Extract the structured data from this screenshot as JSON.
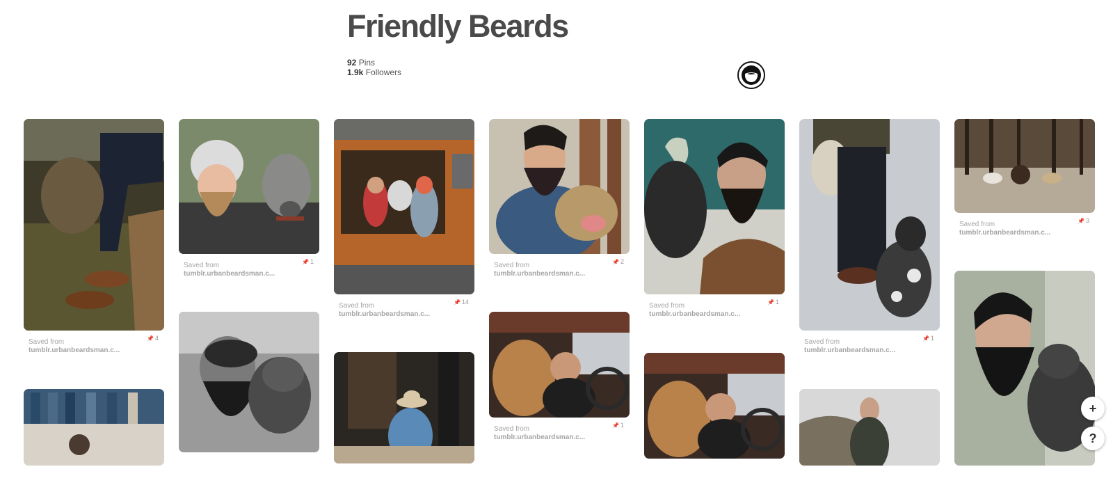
{
  "board": {
    "title": "Friendly Beards",
    "pins_count": "92",
    "pins_label": "Pins",
    "followers_count": "1.9k",
    "followers_label": "Followers"
  },
  "owner": {
    "avatar_icon": "beard-logo-icon"
  },
  "pins": [
    {
      "image": "man-sitting-with-cattle-dog-boots",
      "saved_label": "Saved from",
      "source": "tumblr.urbanbeardsman.c...",
      "repins": "4"
    },
    {
      "image": "denim-clothing-rack",
      "saved_label": "",
      "source": "",
      "repins": ""
    },
    {
      "image": "bearded-man-beanie-with-greyhound",
      "saved_label": "Saved from",
      "source": "tumblr.urbanbeardsman.c...",
      "repins": "1"
    },
    {
      "image": "bw-bearded-man-with-dog",
      "saved_label": "",
      "source": "",
      "repins": ""
    },
    {
      "image": "couple-with-dog-in-orange-van",
      "saved_label": "Saved from",
      "source": "tumblr.urbanbeardsman.c...",
      "repins": "14"
    },
    {
      "image": "man-in-hat-sitting-doorway",
      "saved_label": "",
      "source": "",
      "repins": ""
    },
    {
      "image": "bearded-man-denim-shirt-with-dog",
      "saved_label": "Saved from",
      "source": "tumblr.urbanbeardsman.c...",
      "repins": "2"
    },
    {
      "image": "man-driving-truck-with-dog",
      "saved_label": "Saved from",
      "source": "tumblr.urbanbeardsman.c...",
      "repins": "1"
    },
    {
      "image": "bearded-man-and-dog-teal-wall",
      "saved_label": "Saved from",
      "source": "tumblr.urbanbeardsman.c...",
      "repins": "1"
    },
    {
      "image": "man-driving-truck-with-dog-2",
      "saved_label": "",
      "source": "",
      "repins": ""
    },
    {
      "image": "man-standing-with-cattle-dog",
      "saved_label": "Saved from",
      "source": "tumblr.urbanbeardsman.c...",
      "repins": "1"
    },
    {
      "image": "man-in-jacket-outdoors",
      "saved_label": "",
      "source": "",
      "repins": ""
    },
    {
      "image": "dogs-in-forest",
      "saved_label": "Saved from",
      "source": "tumblr.urbanbeardsman.c...",
      "repins": "3"
    },
    {
      "image": "bearded-man-profile-with-dog",
      "saved_label": "",
      "source": "",
      "repins": ""
    }
  ],
  "fab": {
    "add_label": "+",
    "help_label": "?"
  }
}
